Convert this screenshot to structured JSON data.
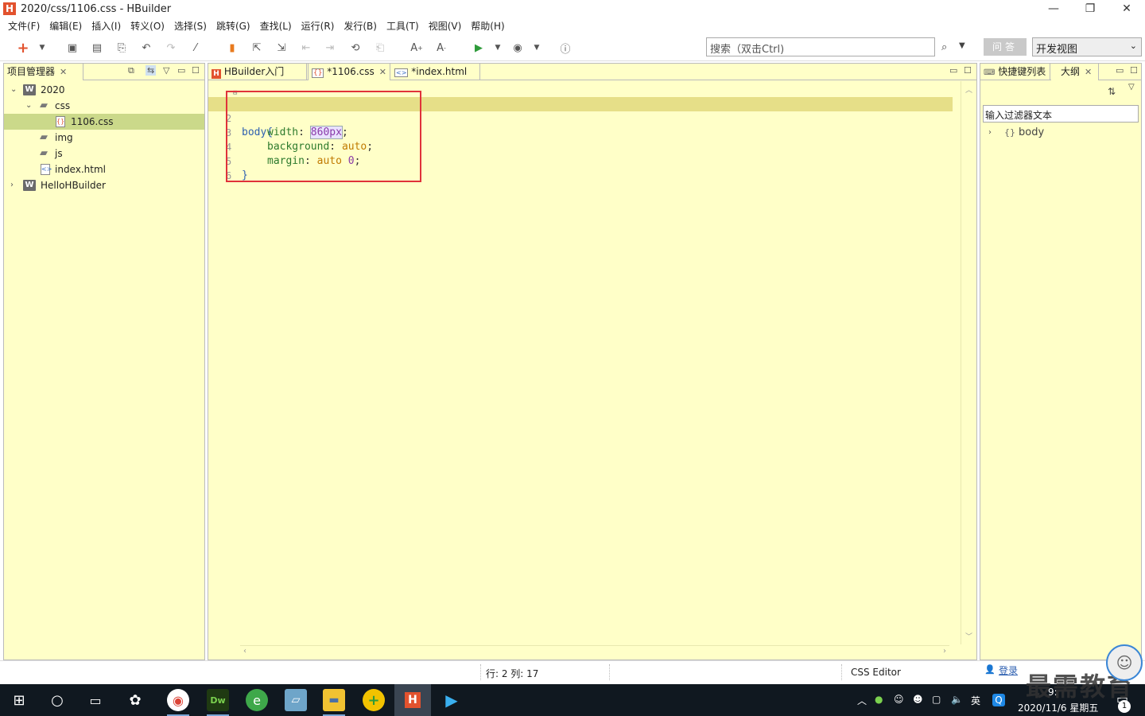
{
  "window": {
    "title": "2020/css/1106.css  -  HBuilder",
    "app_logo": "H",
    "minimize": "—",
    "restore": "❐",
    "close": "✕"
  },
  "menu": [
    "文件(F)",
    "编辑(E)",
    "插入(I)",
    "转义(O)",
    "选择(S)",
    "跳转(G)",
    "查找(L)",
    "运行(R)",
    "发行(B)",
    "工具(T)",
    "视图(V)",
    "帮助(H)"
  ],
  "toolbar": {
    "search_placeholder": "搜索（双击Ctrl)",
    "qa_label": "问答",
    "view_mode": "开发视图"
  },
  "project_panel": {
    "tab_label": "项目管理器",
    "tree": [
      {
        "label": "2020",
        "type": "project",
        "level": 0,
        "expanded": true
      },
      {
        "label": "css",
        "type": "folder",
        "level": 1,
        "expanded": true
      },
      {
        "label": "1106.css",
        "type": "css-file",
        "level": 2,
        "selected": true
      },
      {
        "label": "img",
        "type": "folder",
        "level": 1
      },
      {
        "label": "js",
        "type": "folder",
        "level": 1
      },
      {
        "label": "index.html",
        "type": "html-file",
        "level": 1
      },
      {
        "label": "HelloHBuilder",
        "type": "project",
        "level": 0,
        "expanded": false
      }
    ]
  },
  "editor": {
    "tabs": [
      {
        "label": "HBuilder入门"
      },
      {
        "label": "*1106.css"
      },
      {
        "label": "*index.html"
      }
    ],
    "line_numbers": [
      "1",
      "2",
      "3",
      "4",
      "5",
      "6"
    ],
    "code": {
      "l1_sel": "body",
      "l1_brace": "{",
      "l2_prop": "width",
      "l2_colon": ": ",
      "l2_num": "860",
      "l2_unit": "px",
      "l2_end": ";",
      "l3_prop": "background",
      "l3_colon": ": ",
      "l3_val": "auto",
      "l3_end": ";",
      "l4_prop": "margin",
      "l4_colon": ": ",
      "l4_val": "auto",
      "l4_num": "0",
      "l4_end": ";",
      "l5_brace": "}"
    }
  },
  "right_panel": {
    "tabs": [
      {
        "label": "快捷键列表"
      },
      {
        "label": "大纲"
      }
    ],
    "filter_placeholder": "输入过滤器文本",
    "outline_brace": "{}",
    "outline_item": "body"
  },
  "status": {
    "position": "行: 2 列: 17",
    "editor_type": "CSS Editor",
    "login": "登录"
  },
  "taskbar": {
    "tray_lang": "英",
    "time": "9:",
    "date": "2020/11/6 星期五",
    "badge": "1"
  },
  "watermark": "最需教育",
  "colors": {
    "panel_bg": "#ffffc8",
    "current_line": "#e6df88",
    "selected_tree": "#cbd98a",
    "highlight_box": "#e0323a",
    "brand": "#e2522e"
  }
}
